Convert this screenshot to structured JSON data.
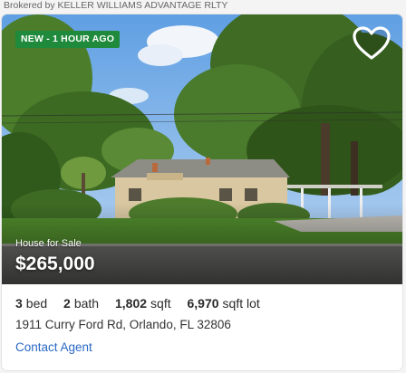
{
  "broker": "Brokered by KELLER WILLIAMS ADVANTAGE RLTY",
  "listing": {
    "badge": "NEW - 1 HOUR AGO",
    "property_type": "House for Sale",
    "price": "$265,000",
    "stats": [
      {
        "value": "3",
        "unit": "bed"
      },
      {
        "value": "2",
        "unit": "bath"
      },
      {
        "value": "1,802",
        "unit": "sqft"
      },
      {
        "value": "6,970",
        "unit": "sqft lot"
      }
    ],
    "address": "1911 Curry Ford Rd, Orlando, FL 32806",
    "contact_label": "Contact Agent"
  },
  "icons": {
    "favorite": "heart-outline-icon"
  },
  "colors": {
    "badge": "#1f8a3b",
    "link": "#2a68c4"
  }
}
